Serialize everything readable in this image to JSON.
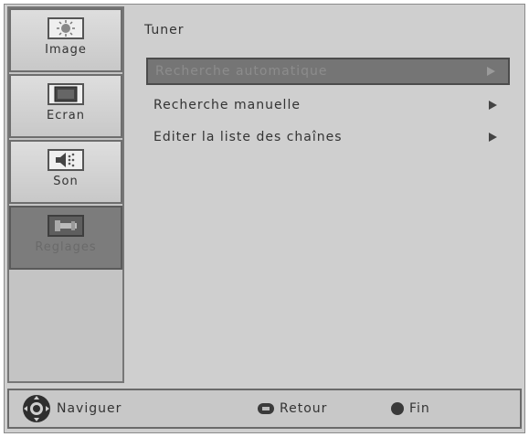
{
  "sidebar": {
    "items": [
      {
        "label": "Image",
        "icon": "picture-icon"
      },
      {
        "label": "Ecran",
        "icon": "screen-icon"
      },
      {
        "label": "Son",
        "icon": "speaker-icon"
      },
      {
        "label": "Reglages",
        "icon": "settings-icon"
      }
    ],
    "selected_index": 3
  },
  "main": {
    "title": "Tuner",
    "menu": [
      {
        "label": "Recherche automatique",
        "selected": true
      },
      {
        "label": "Recherche manuelle",
        "selected": false
      },
      {
        "label": "Editer la liste des chaînes",
        "selected": false
      }
    ]
  },
  "footer": {
    "navigate_label": "Naviguer",
    "back_label": "Retour",
    "end_label": "Fin"
  },
  "colors": {
    "panel": "#cfcfcf",
    "selected": "#757575",
    "text": "#333333"
  }
}
